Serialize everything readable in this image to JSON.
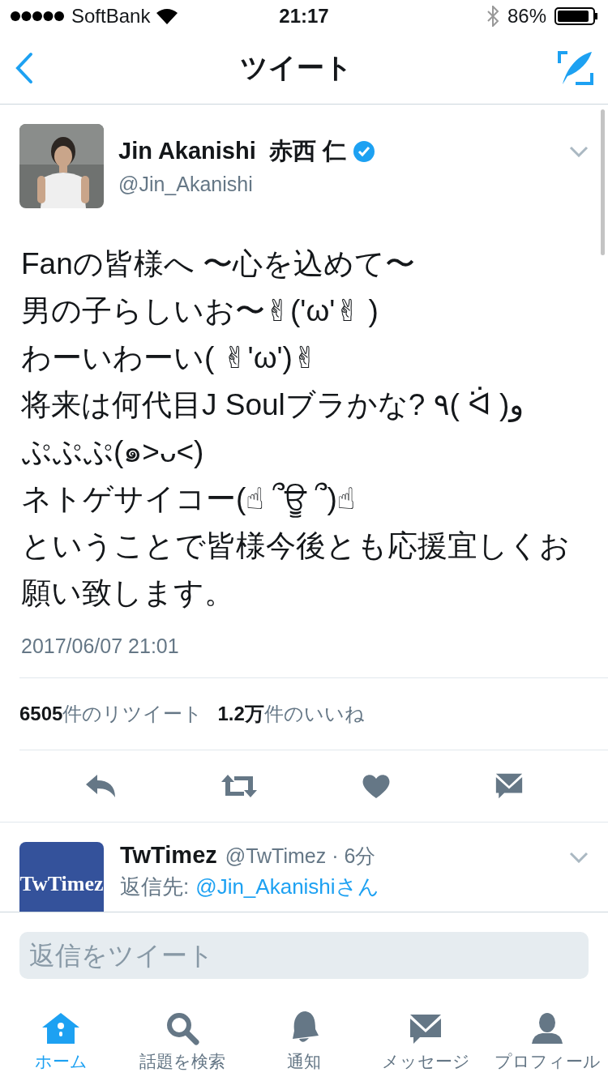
{
  "status_bar": {
    "carrier": "SoftBank",
    "time": "21:17",
    "battery": "86%"
  },
  "nav": {
    "title": "ツイート"
  },
  "tweet": {
    "name": "Jin Akanishi  赤西 仁",
    "verified": true,
    "handle": "@Jin_Akanishi",
    "text_lines": [
      "Fanの皆様へ 〜心を込めて〜",
      "男の子らしいお〜✌('ω'✌ )",
      "わーいわーい( ✌'ω')✌",
      "将来は何代目J Soulブラかな? ٩( ᐛ )و",
      "ぷぷぷ(๑˃ᴗ˂)",
      "ネトゲサイコー(☝ ՞ਊ ՞)☝",
      "ということで皆様今後とも応援宜しくお願い致します。"
    ],
    "date": "2017/06/07 21:01",
    "stats": [
      "**6505**件のリツイート",
      "**1.2万**件のいいね"
    ]
  },
  "reply": {
    "avatar_label": "TwTimez",
    "name": "TwTimez",
    "handle": "@TwTimez · 6分",
    "reply_label": "返信先:",
    "reply_to": "@Jin_Akanishiさん"
  },
  "compose": {
    "placeholder": "返信をツイート"
  },
  "tabs": [
    {
      "label": "ホーム",
      "kind": "home",
      "selected": true
    },
    {
      "label": "話題を検索",
      "kind": "search",
      "selected": false
    },
    {
      "label": "通知",
      "kind": "bell",
      "selected": false
    },
    {
      "label": "メッセージ",
      "kind": "mail",
      "selected": false
    },
    {
      "label": "プロフィール",
      "kind": "person",
      "selected": false
    }
  ]
}
